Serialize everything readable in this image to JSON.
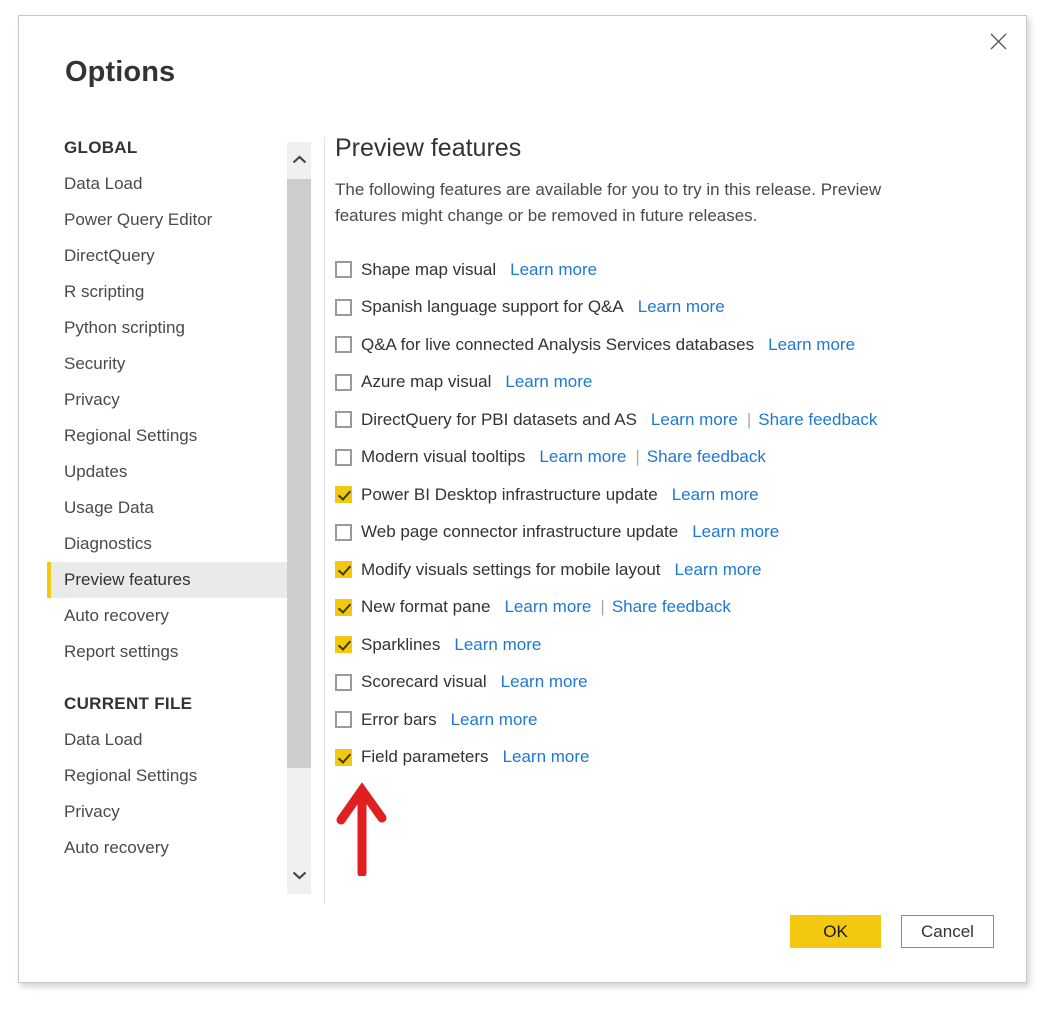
{
  "dialog": {
    "title": "Options",
    "close_icon": "close-icon"
  },
  "sidebar": {
    "groups": [
      {
        "title": "GLOBAL",
        "items": [
          {
            "label": "Data Load",
            "selected": false
          },
          {
            "label": "Power Query Editor",
            "selected": false
          },
          {
            "label": "DirectQuery",
            "selected": false
          },
          {
            "label": "R scripting",
            "selected": false
          },
          {
            "label": "Python scripting",
            "selected": false
          },
          {
            "label": "Security",
            "selected": false
          },
          {
            "label": "Privacy",
            "selected": false
          },
          {
            "label": "Regional Settings",
            "selected": false
          },
          {
            "label": "Updates",
            "selected": false
          },
          {
            "label": "Usage Data",
            "selected": false
          },
          {
            "label": "Diagnostics",
            "selected": false
          },
          {
            "label": "Preview features",
            "selected": true
          },
          {
            "label": "Auto recovery",
            "selected": false
          },
          {
            "label": "Report settings",
            "selected": false
          }
        ]
      },
      {
        "title": "CURRENT FILE",
        "items": [
          {
            "label": "Data Load",
            "selected": false
          },
          {
            "label": "Regional Settings",
            "selected": false
          },
          {
            "label": "Privacy",
            "selected": false
          },
          {
            "label": "Auto recovery",
            "selected": false
          }
        ]
      }
    ],
    "scrollbar": {
      "up_icon": "chevron-up-icon",
      "down_icon": "chevron-down-icon"
    }
  },
  "main": {
    "heading": "Preview features",
    "description": "The following features are available for you to try in this release. Preview features might change or be removed in future releases.",
    "learn_more_label": "Learn more",
    "share_feedback_label": "Share feedback",
    "separator": "|",
    "features": [
      {
        "label": "Shape map visual",
        "checked": false,
        "learn_more": true,
        "share_feedback": false
      },
      {
        "label": "Spanish language support for Q&A",
        "checked": false,
        "learn_more": true,
        "share_feedback": false
      },
      {
        "label": "Q&A for live connected Analysis Services databases",
        "checked": false,
        "learn_more": true,
        "share_feedback": false
      },
      {
        "label": "Azure map visual",
        "checked": false,
        "learn_more": true,
        "share_feedback": false
      },
      {
        "label": "DirectQuery for PBI datasets and AS",
        "checked": false,
        "learn_more": true,
        "share_feedback": true
      },
      {
        "label": "Modern visual tooltips",
        "checked": false,
        "learn_more": true,
        "share_feedback": true
      },
      {
        "label": "Power BI Desktop infrastructure update",
        "checked": true,
        "learn_more": true,
        "share_feedback": false
      },
      {
        "label": "Web page connector infrastructure update",
        "checked": false,
        "learn_more": true,
        "share_feedback": false
      },
      {
        "label": "Modify visuals settings for mobile layout",
        "checked": true,
        "learn_more": true,
        "share_feedback": false
      },
      {
        "label": "New format pane",
        "checked": true,
        "learn_more": true,
        "share_feedback": true
      },
      {
        "label": "Sparklines",
        "checked": true,
        "learn_more": true,
        "share_feedback": false
      },
      {
        "label": "Scorecard visual",
        "checked": false,
        "learn_more": true,
        "share_feedback": false
      },
      {
        "label": "Error bars",
        "checked": false,
        "learn_more": true,
        "share_feedback": false
      },
      {
        "label": "Field parameters",
        "checked": true,
        "learn_more": true,
        "share_feedback": false
      }
    ]
  },
  "annotation": {
    "arrow_icon": "red-up-arrow-annotation",
    "color": "#E02020",
    "points_at": "Field parameters"
  },
  "footer": {
    "ok_label": "OK",
    "cancel_label": "Cancel"
  },
  "colors": {
    "accent": "#F2C811",
    "link": "#1F78D1",
    "text": "#333333",
    "selected_bg": "#EAEAEA"
  }
}
